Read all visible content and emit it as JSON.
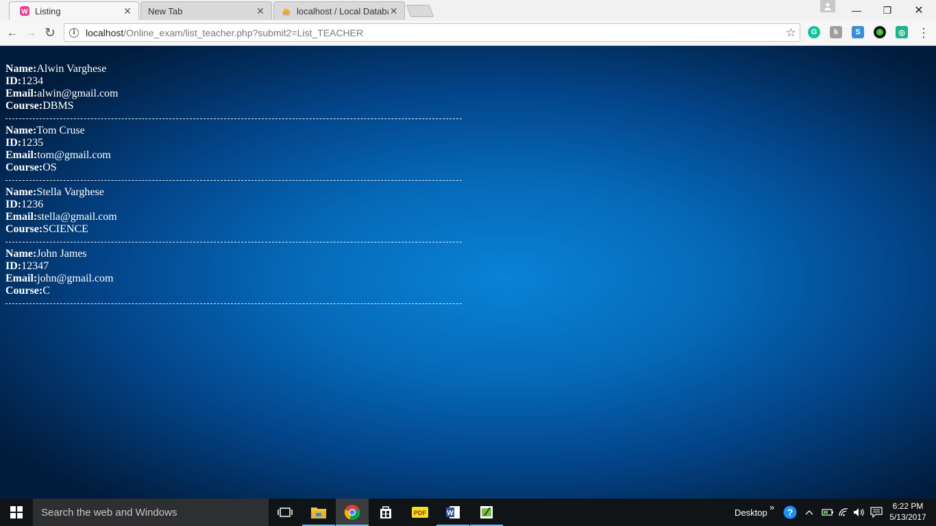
{
  "browser": {
    "tabs": [
      {
        "title": "Listing",
        "favicon": "wamp-icon",
        "close": "✕"
      },
      {
        "title": "New Tab",
        "close": "✕"
      },
      {
        "title": "localhost / Local Databas",
        "favicon": "phpmyadmin-icon",
        "favicon_text": "PMA",
        "close": "✕"
      }
    ],
    "window_controls": {
      "minimize": "—",
      "restore": "❐",
      "close": "✕"
    },
    "url_host": "localhost",
    "url_path": "/Online_exam/list_teacher.php?submit2=List_TEACHER",
    "nav": {
      "back": "←",
      "forward": "→",
      "reload": "↻",
      "star": "☆",
      "menu": "⋮"
    }
  },
  "page": {
    "labels": {
      "name": "Name:",
      "id": "ID:",
      "email": "Email:",
      "course": "Course:"
    },
    "teachers": [
      {
        "name": "Alwin Varghese",
        "id": "1234",
        "email": "alwin@gmail.com",
        "course": "DBMS"
      },
      {
        "name": "Tom Cruse",
        "id": "1235",
        "email": "tom@gmail.com",
        "course": "OS"
      },
      {
        "name": "Stella Varghese",
        "id": "1236",
        "email": "stella@gmail.com",
        "course": "SCIENCE"
      },
      {
        "name": "John James",
        "id": "12347",
        "email": "john@gmail.com",
        "course": "C"
      }
    ]
  },
  "taskbar": {
    "search_placeholder": "Search the web and Windows",
    "desktop_label": "Desktop",
    "chevron": "»",
    "time": "6:22 PM",
    "date": "5/13/2017"
  }
}
